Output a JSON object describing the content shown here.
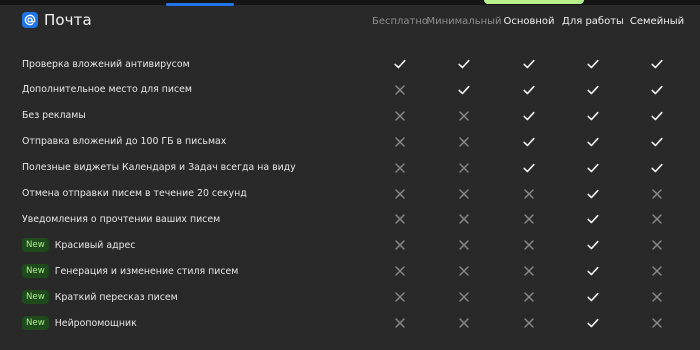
{
  "header": {
    "product_name": "Почта",
    "logo_icon": "at-sign-icon",
    "brand_color": "#1e74e8"
  },
  "plans": [
    {
      "label": "Бесплатно",
      "state": "muted"
    },
    {
      "label": "Минимальный",
      "state": "muted"
    },
    {
      "label": "Основной",
      "state": "active"
    },
    {
      "label": "Для работы",
      "state": "active"
    },
    {
      "label": "Семейный",
      "state": "active"
    }
  ],
  "features": [
    {
      "label": "Проверка вложений антивирусом",
      "is_new": false,
      "availability": [
        true,
        true,
        true,
        true,
        true
      ]
    },
    {
      "label": "Дополнительное место для писем",
      "is_new": false,
      "availability": [
        false,
        true,
        true,
        true,
        true
      ]
    },
    {
      "label": "Без рекламы",
      "is_new": false,
      "availability": [
        false,
        false,
        true,
        true,
        true
      ]
    },
    {
      "label": "Отправка вложений до 100 ГБ в письмах",
      "is_new": false,
      "availability": [
        false,
        false,
        true,
        true,
        true
      ]
    },
    {
      "label": "Полезные виджеты Календаря и Задач всегда на виду",
      "is_new": false,
      "availability": [
        false,
        false,
        true,
        true,
        true
      ]
    },
    {
      "label": "Отмена отправки писем в течение 20 секунд",
      "is_new": false,
      "availability": [
        false,
        false,
        false,
        true,
        false
      ]
    },
    {
      "label": "Уведомления о прочтении ваших писем",
      "is_new": false,
      "availability": [
        false,
        false,
        false,
        true,
        false
      ]
    },
    {
      "label": "Красивый адрес",
      "is_new": true,
      "availability": [
        false,
        false,
        false,
        true,
        false
      ]
    },
    {
      "label": "Генерация и изменение стиля писем",
      "is_new": true,
      "availability": [
        false,
        false,
        false,
        true,
        false
      ]
    },
    {
      "label": "Краткий пересказ писем",
      "is_new": true,
      "availability": [
        false,
        false,
        false,
        true,
        false
      ]
    },
    {
      "label": "Нейропомощник",
      "is_new": true,
      "availability": [
        false,
        false,
        false,
        true,
        false
      ]
    }
  ],
  "badge": {
    "new_label": "New",
    "bg_color": "#1f4a1c",
    "text_color": "#a9ee8a"
  },
  "icons": {
    "available": "check-icon",
    "unavailable": "cross-icon"
  },
  "colors": {
    "background": "#292929",
    "check": "#f2f2f2",
    "cross": "#8a8a8a"
  }
}
